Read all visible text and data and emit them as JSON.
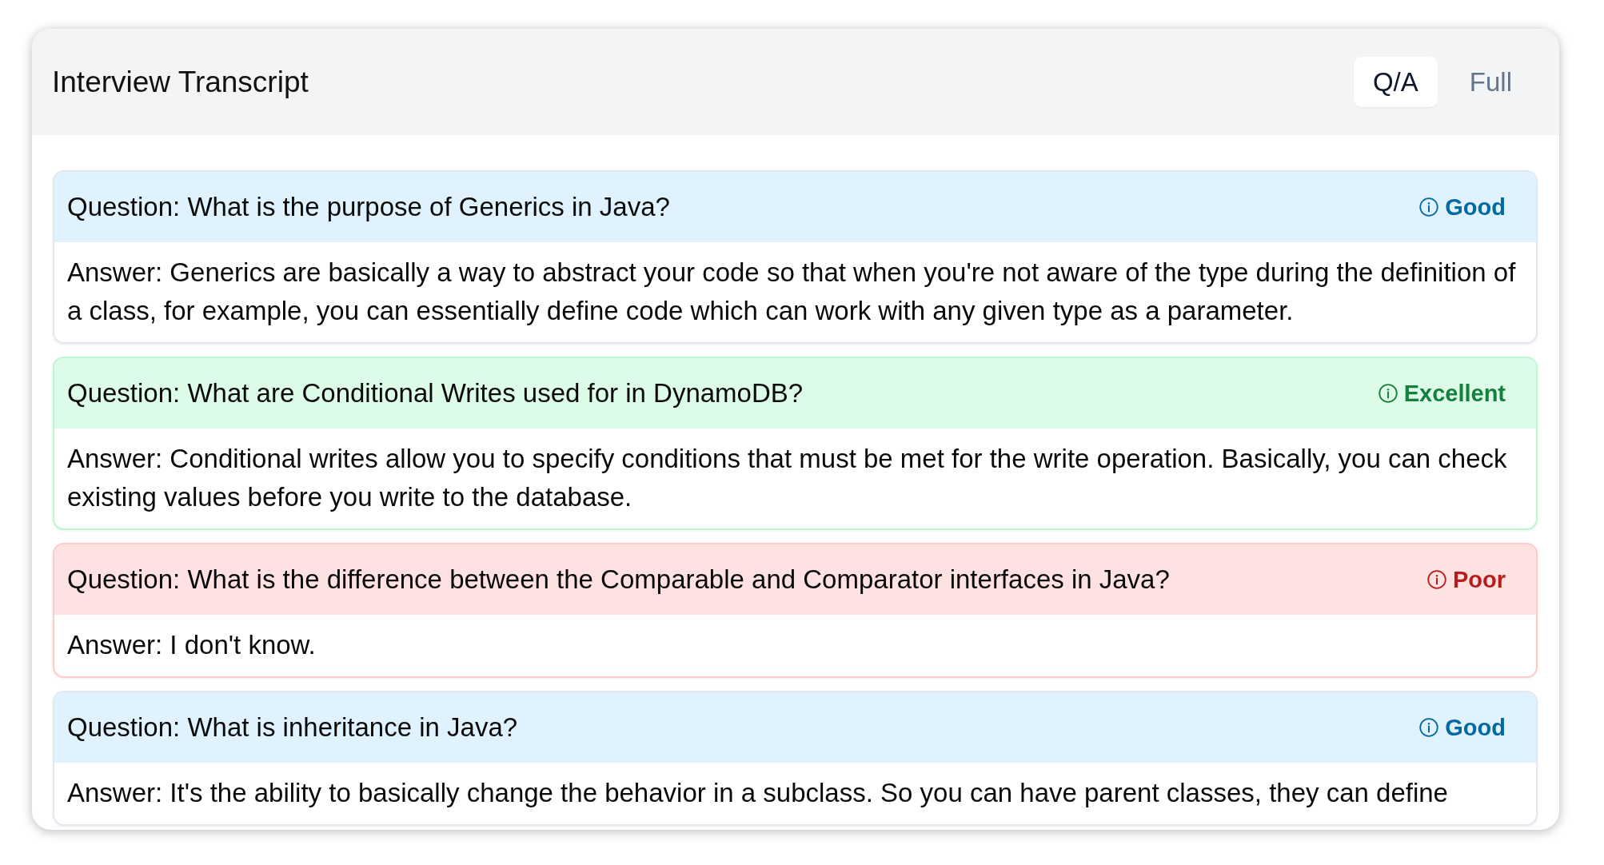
{
  "window": {
    "title": "Interview Transcript"
  },
  "tabs": [
    {
      "label": "Q/A",
      "selected": true
    },
    {
      "label": "Full",
      "selected": false
    }
  ],
  "items": [
    {
      "kind": "good",
      "question": "Question: What is the purpose of Generics in Java?",
      "rating": "Good",
      "answer": "Answer: Generics are basically a way to abstract your code so that when you're not aware of the type during the definition of a class, for example, you can essentially define code which can work with any given type as a parameter."
    },
    {
      "kind": "excellent",
      "question": "Question: What are Conditional Writes used for in DynamoDB?",
      "rating": "Excellent",
      "answer": "Answer: Conditional writes allow you to specify conditions that must be met for the write operation. Basically, you can check existing values before you write to the database."
    },
    {
      "kind": "poor",
      "question": "Question: What is the difference between the Comparable and Comparator interfaces in Java?",
      "rating": "Poor",
      "answer": "Answer: I don't know."
    },
    {
      "kind": "good",
      "question": "Question: What is inheritance in Java?",
      "rating": "Good",
      "answer": "Answer: It's the ability to basically change the behavior in a subclass. So you can have parent classes, they can define"
    }
  ]
}
